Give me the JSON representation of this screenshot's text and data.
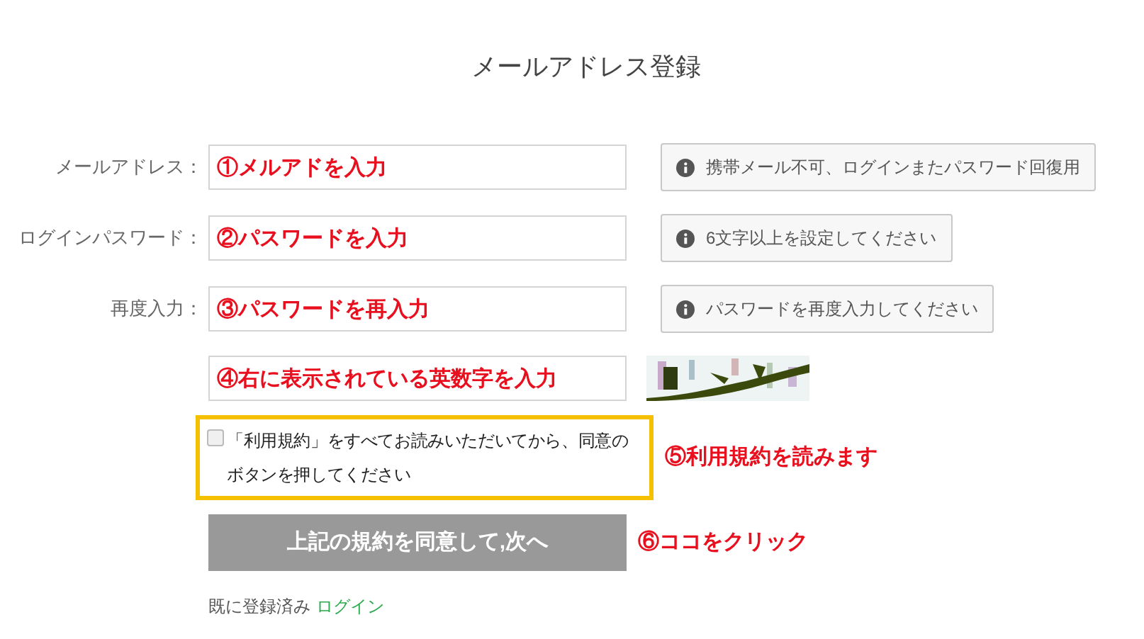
{
  "title": "メールアドレス登録",
  "fields": [
    {
      "label": "メールアドレス：",
      "annotation": "①メルアドを入力",
      "hint": "携帯メール不可、ログインまたパスワード回復用"
    },
    {
      "label": "ログインパスワード：",
      "annotation": "②パスワードを入力",
      "hint": "6文字以上を設定してください"
    },
    {
      "label": "再度入力：",
      "annotation": "③パスワードを再入力",
      "hint": "パスワードを再度入力してください"
    }
  ],
  "captcha": {
    "annotation": "④右に表示されている英数字を入力",
    "kind": "picture"
  },
  "agreement": {
    "text": "「利用規約」をすべてお読みいただいてから、同意のボタンを押してください",
    "checked": false,
    "annotation": "⑤利用規約を読みます"
  },
  "submit": {
    "label": "上記の規約を同意して,次へ",
    "annotation": "⑥ココをクリック"
  },
  "footer": {
    "text": "既に登録済み",
    "link": "ログイン"
  }
}
